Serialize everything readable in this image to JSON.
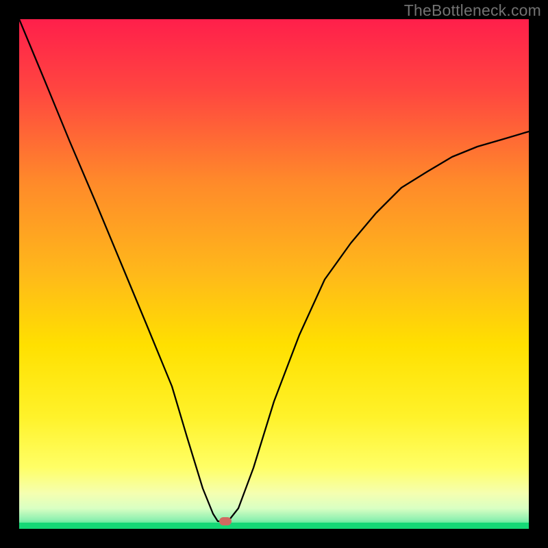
{
  "watermark": "TheBottleneck.com",
  "chart_data": {
    "type": "line",
    "title": "",
    "xlabel": "",
    "ylabel": "",
    "xlim": [
      0,
      100
    ],
    "ylim": [
      0,
      100
    ],
    "grid": false,
    "legend": false,
    "background_gradient": {
      "top": "#ff1f4b",
      "mid_upper": "#ff8a2a",
      "mid": "#ffe000",
      "mid_lower": "#ffff66",
      "bottom": "#19e27a"
    },
    "series": [
      {
        "name": "bottleneck-curve",
        "x": [
          0,
          5,
          10,
          15,
          20,
          25,
          30,
          33,
          36,
          38,
          39,
          41,
          43,
          46,
          50,
          55,
          60,
          65,
          70,
          75,
          80,
          85,
          90,
          95,
          100
        ],
        "y": [
          100,
          88,
          76,
          64,
          52,
          40,
          28,
          18,
          8,
          3,
          1.5,
          1.5,
          4,
          12,
          25,
          38,
          49,
          56,
          62,
          67,
          70,
          73,
          75,
          76.5,
          78
        ]
      }
    ],
    "marker": {
      "name": "minimum-point",
      "x": 40,
      "y": 1.5,
      "color": "#d06a60",
      "shape": "rounded"
    },
    "bottom_band": {
      "description": "thin green band at base indicating optimal zone",
      "y_range": [
        0,
        1.2
      ]
    }
  }
}
